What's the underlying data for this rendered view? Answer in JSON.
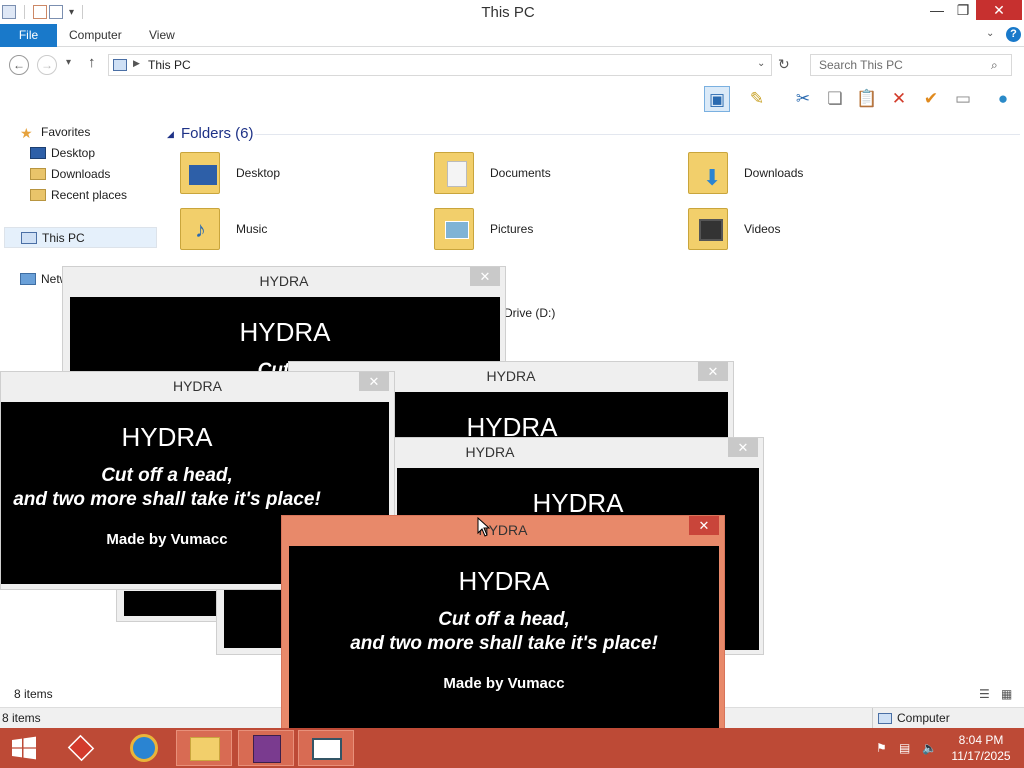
{
  "explorer": {
    "title": "This PC",
    "tabs": {
      "file": "File",
      "computer": "Computer",
      "view": "View"
    },
    "address": "This PC",
    "search_placeholder": "Search This PC",
    "nav": {
      "favorites": "Favorites",
      "desktop": "Desktop",
      "downloads": "Downloads",
      "recent": "Recent places",
      "this_pc": "This PC",
      "network": "Netw"
    },
    "folders_heading": "Folders (6)",
    "folders": [
      "Desktop",
      "Documents",
      "Downloads",
      "Music",
      "Pictures",
      "Videos"
    ],
    "drive_label": "Drive (D:)",
    "status_items": "8 items",
    "status_bottom_items": "8 items",
    "status_computer": "Computer"
  },
  "hydra": {
    "window_title": "HYDRA",
    "heading": "HYDRA",
    "line1": "Cut off a head,",
    "line2": "and two more shall take it's place!",
    "credit": "Made by Vumacc",
    "partial_line": "Cut of",
    "close_glyph": "✕"
  },
  "taskbar": {
    "time": "8:04 PM",
    "date": "11/17/2025"
  },
  "colors": {
    "taskbar": "#bd4a36",
    "file_tab": "#1979ca",
    "active_popup_frame": "#e8896a"
  }
}
